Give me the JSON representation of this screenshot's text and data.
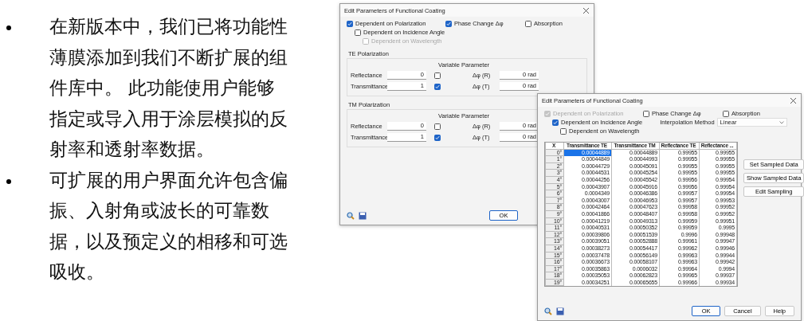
{
  "bullets": [
    {
      "text": "在新版本中，我们已将功能性薄膜添加到我们不断扩展的组件库中。 此功能使用户能够指定或导入用于涂层模拟的反射率和透射率数据。"
    },
    {
      "text": "可扩展的用户界面允许包含偏振、入射角或波长的可靠数据，以及预定义的相移和可选吸收。"
    }
  ],
  "coating_dialog": {
    "title": "Edit Parameters of Functional Coating",
    "options": [
      {
        "label": "Dependent on Polarization",
        "checked": true,
        "disabled": false,
        "children": [
          {
            "label": "Dependent on Incidence Angle",
            "checked": false,
            "disabled": false,
            "children": [
              {
                "label": "Dependent on Wavelength",
                "checked": false,
                "disabled": true
              }
            ]
          }
        ]
      },
      {
        "label": "Phase Change Δφ",
        "checked": true,
        "disabled": false
      },
      {
        "label": "Absorption",
        "checked": false,
        "disabled": false
      }
    ],
    "groups": [
      {
        "title": "TE Polarization",
        "column_heading": "Variable Parameter",
        "rows": [
          {
            "label": "Reflectance",
            "value": "0",
            "variable": false,
            "phase_label": "Δφ (R)",
            "phase_value": "0 rad"
          },
          {
            "label": "Transmittance",
            "value": "1",
            "variable": true,
            "phase_label": "Δφ (T)",
            "phase_value": "0 rad"
          }
        ]
      },
      {
        "title": "TM Polarization",
        "column_heading": "Variable Parameter",
        "rows": [
          {
            "label": "Reflectance",
            "value": "0",
            "variable": false,
            "phase_label": "Δφ (R)",
            "phase_value": "0 rad"
          },
          {
            "label": "Transmittance",
            "value": "1",
            "variable": true,
            "phase_label": "Δφ (T)",
            "phase_value": "0 rad"
          }
        ]
      }
    ],
    "buttons": [
      "OK"
    ]
  },
  "sampled_dialog": {
    "title": "Edit Parameters of Functional Coating",
    "options": [
      {
        "label": "Dependent on Polarization",
        "checked": true,
        "disabled": true,
        "children": [
          {
            "label": "Dependent on Incidence Angle",
            "checked": true,
            "disabled": false,
            "children": [
              {
                "label": "Dependent on Wavelength",
                "checked": false,
                "disabled": false
              }
            ]
          }
        ]
      },
      {
        "label": "Phase Change Δφ",
        "checked": false,
        "disabled": false
      },
      {
        "label": "Absorption",
        "checked": false,
        "disabled": false
      }
    ],
    "interpolation": {
      "label": "Interpolation Method",
      "value": "Linear"
    },
    "table": {
      "columns": [
        "X",
        "Transmittance TE",
        "Transmittance TM",
        "Reflectance TE",
        "Reflectance ..."
      ],
      "rows": [
        {
          "cells": [
            "0°",
            "0.00044889",
            "0.00044889",
            "0.99955",
            "0.99955"
          ],
          "selected": true
        },
        {
          "cells": [
            "1°",
            "0.00044849",
            "0.00044993",
            "0.99955",
            "0.99955"
          ],
          "selected": false
        },
        {
          "cells": [
            "2°",
            "0.00044729",
            "0.00045091",
            "0.99955",
            "0.99955"
          ],
          "selected": false
        },
        {
          "cells": [
            "3°",
            "0.00044531",
            "0.00045254",
            "0.99955",
            "0.99955"
          ],
          "selected": false
        },
        {
          "cells": [
            "4°",
            "0.00044256",
            "0.00045542",
            "0.99956",
            "0.99954"
          ],
          "selected": false
        },
        {
          "cells": [
            "5°",
            "0.00043907",
            "0.00045916",
            "0.99956",
            "0.99954"
          ],
          "selected": false
        },
        {
          "cells": [
            "6°",
            "0.0004349",
            "0.00046386",
            "0.99957",
            "0.99954"
          ],
          "selected": false
        },
        {
          "cells": [
            "7°",
            "0.00043007",
            "0.00046953",
            "0.99957",
            "0.99953"
          ],
          "selected": false
        },
        {
          "cells": [
            "8°",
            "0.00042464",
            "0.00047623",
            "0.99958",
            "0.99952"
          ],
          "selected": false
        },
        {
          "cells": [
            "9°",
            "0.00041866",
            "0.00048407",
            "0.99958",
            "0.99952"
          ],
          "selected": false
        },
        {
          "cells": [
            "10°",
            "0.00041219",
            "0.00049313",
            "0.99959",
            "0.99951"
          ],
          "selected": false
        },
        {
          "cells": [
            "11°",
            "0.00040531",
            "0.00050352",
            "0.99959",
            "0.9995"
          ],
          "selected": false
        },
        {
          "cells": [
            "12°",
            "0.00039806",
            "0.00051539",
            "0.9996",
            "0.99948"
          ],
          "selected": false
        },
        {
          "cells": [
            "13°",
            "0.00039051",
            "0.00052888",
            "0.99961",
            "0.99947"
          ],
          "selected": false
        },
        {
          "cells": [
            "14°",
            "0.00038273",
            "0.00054417",
            "0.99962",
            "0.99946"
          ],
          "selected": false
        },
        {
          "cells": [
            "15°",
            "0.00037478",
            "0.00056149",
            "0.99963",
            "0.99944"
          ],
          "selected": false
        },
        {
          "cells": [
            "16°",
            "0.00036673",
            "0.00058107",
            "0.99963",
            "0.99942"
          ],
          "selected": false
        },
        {
          "cells": [
            "17°",
            "0.00035863",
            "0.0006032",
            "0.99964",
            "0.9994"
          ],
          "selected": false
        },
        {
          "cells": [
            "18°",
            "0.00035053",
            "0.00062823",
            "0.99965",
            "0.99937"
          ],
          "selected": false
        },
        {
          "cells": [
            "19°",
            "0.00034251",
            "0.00065655",
            "0.99966",
            "0.99934"
          ],
          "selected": false
        }
      ]
    },
    "side_buttons": [
      "Set Sampled Data",
      "Show Sampled Data",
      "Edit Sampling"
    ],
    "buttons": [
      "OK",
      "Cancel",
      "Help"
    ]
  }
}
